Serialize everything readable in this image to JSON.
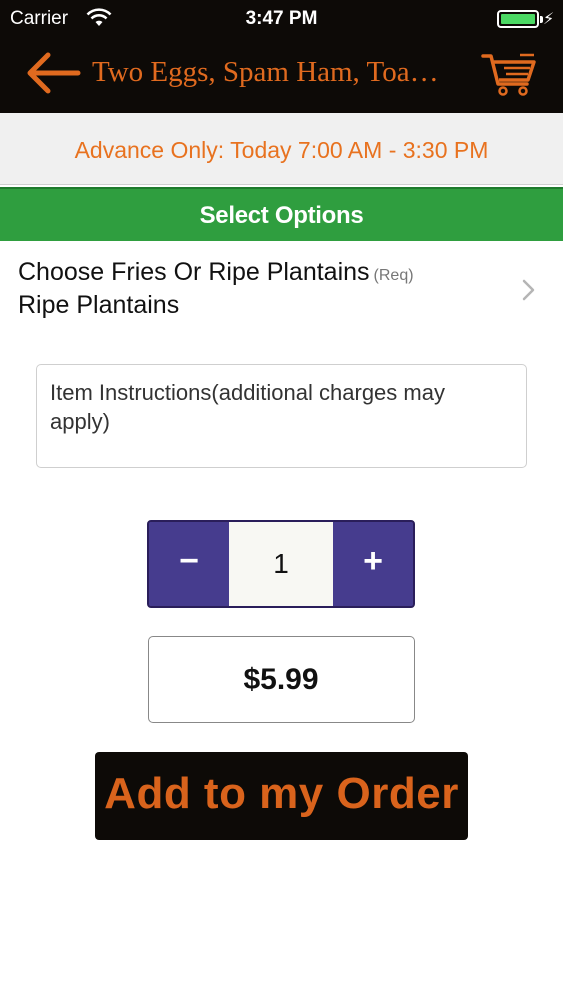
{
  "status_bar": {
    "carrier": "Carrier",
    "time": "3:47 PM",
    "battery_color": "#4cd964"
  },
  "nav": {
    "title": "Two Eggs, Spam Ham, Toa…",
    "back_icon": "arrow-left-icon",
    "cart_icon": "cart-icon",
    "accent_color": "#e06a1f"
  },
  "banner": {
    "text": "Advance Only: Today 7:00 AM - 3:30 PM"
  },
  "section": {
    "title": "Select Options",
    "color": "#2f9e3f"
  },
  "option": {
    "title": "Choose Fries Or Ripe Plantains",
    "required_tag": "(Req)",
    "selected": "Ripe Plantains"
  },
  "instructions": {
    "placeholder": "Item Instructions(additional charges may apply)"
  },
  "quantity": {
    "minus_label": "−",
    "value": "1",
    "plus_label": "+",
    "color": "#463c8e"
  },
  "price": {
    "value": "$5.99"
  },
  "add_button": {
    "label": "Add to my Order",
    "color": "#d9631c"
  }
}
